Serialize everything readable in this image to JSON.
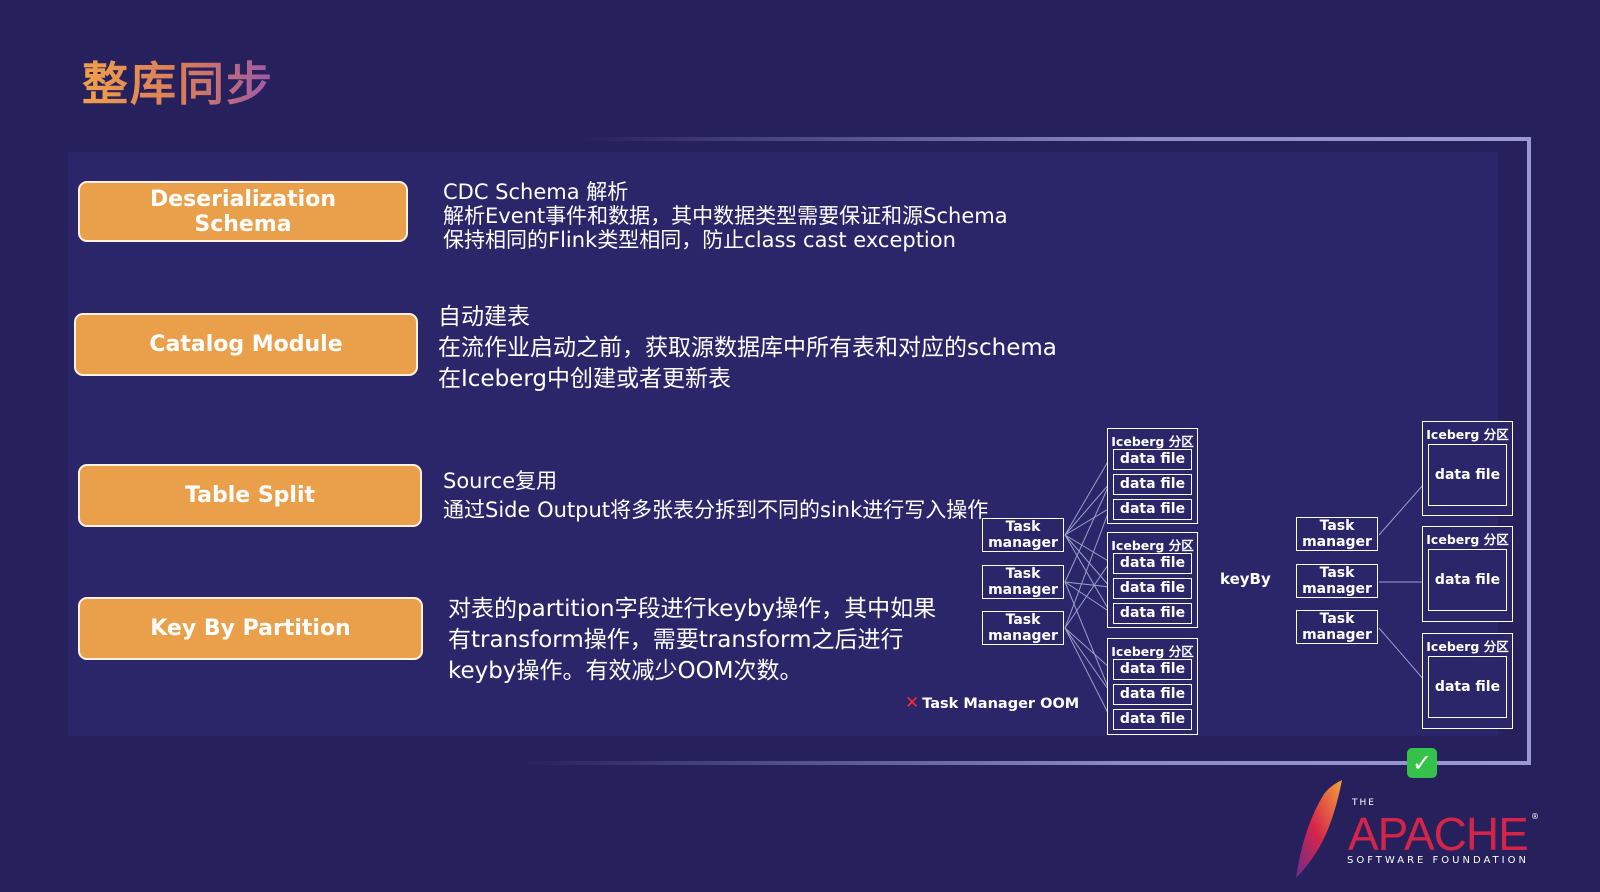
{
  "slide": {
    "title": "整库同步"
  },
  "sections": [
    {
      "label": "Deserialization Schema",
      "lines": [
        "CDC Schema 解析",
        "解析Event事件和数据，其中数据类型需要保证和源Schema",
        "保持相同的Flink类型相同，防止class cast exception"
      ]
    },
    {
      "label": "Catalog Module",
      "lines": [
        "自动建表",
        "在流作业启动之前，获取源数据库中所有表和对应的schema",
        "在Iceberg中创建或者更新表"
      ]
    },
    {
      "label": "Table Split",
      "lines": [
        "Source复用",
        "通过Side Output将多张表分拆到不同的sink进行写入操作"
      ]
    },
    {
      "label": "Key By Partition",
      "lines": [
        "对表的partition字段进行keyby操作，其中如果",
        "有transform操作，需要transform之后进行",
        "keyby操作。有效减少OOM次数。"
      ]
    }
  ],
  "diagram": {
    "task_manager_label_line1": "Task",
    "task_manager_label_line2": "manager",
    "iceberg_partition_label": "Iceberg 分区",
    "data_file_label": "data file",
    "keyby_label": "keyBy",
    "oom_mark": "✕",
    "oom_label": "Task Manager OOM",
    "ok_mark": "✓"
  },
  "logo": {
    "the": "THE",
    "name": "APACHE",
    "registered": "®",
    "subtitle": "SOFTWARE FOUNDATION"
  },
  "colors": {
    "background": "#26215c",
    "pill": "#eaa04a",
    "apache_red": "#d5244a",
    "check_green": "#35c24a",
    "oom_red": "#ff2a2a"
  }
}
